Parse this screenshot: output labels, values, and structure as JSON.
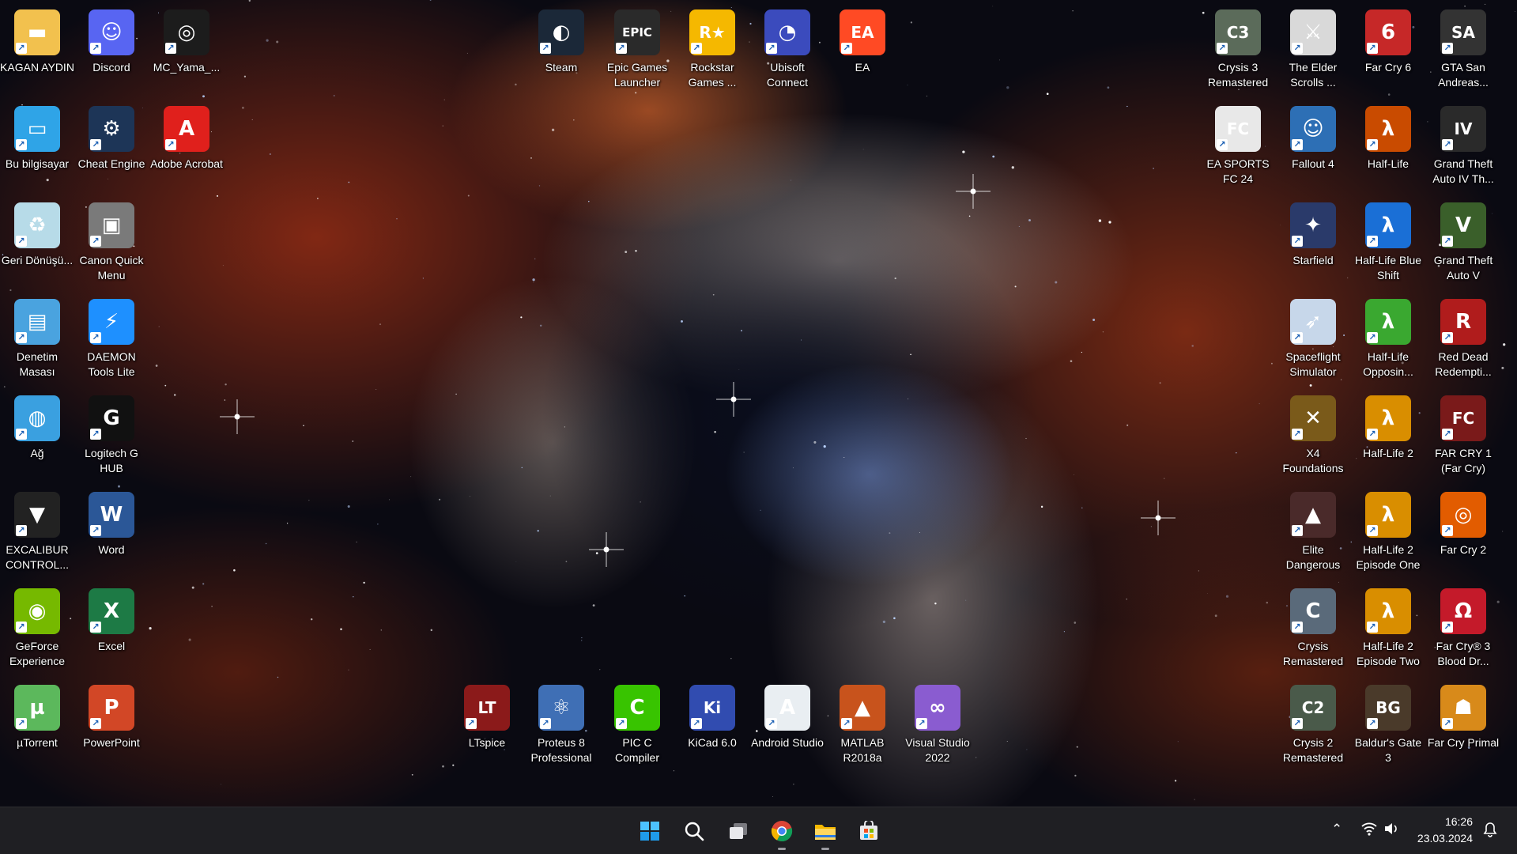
{
  "desktop": {
    "icons_left": [
      {
        "label": "KAGAN AYDIN",
        "icon": "user-folder-icon",
        "color": "#f2c14e",
        "glyph": "▬"
      },
      {
        "label": "Discord",
        "icon": "discord-icon",
        "color": "#5865f2",
        "glyph": "☺"
      },
      {
        "label": "MC_Yama_...",
        "icon": "mc-yama-icon",
        "color": "#1c1c1c",
        "glyph": "◎"
      },
      {
        "label": "Bu bilgisayar",
        "icon": "computer-icon",
        "color": "#2fa4e7",
        "glyph": "▭"
      },
      {
        "label": "Cheat Engine",
        "icon": "cheat-engine-icon",
        "color": "#1d3557",
        "glyph": "⚙"
      },
      {
        "label": "Adobe Acrobat",
        "icon": "adobe-acrobat-icon",
        "color": "#e0201c",
        "glyph": "A"
      },
      {
        "label": "Geri Dönüşü...",
        "icon": "recycle-bin-icon",
        "color": "#b7dbe8",
        "glyph": "♻"
      },
      {
        "label": "Canon Quick Menu",
        "icon": "canon-quick-menu-icon",
        "color": "#7a7a7a",
        "glyph": "▣"
      },
      {
        "label": "Denetim Masası",
        "icon": "control-panel-icon",
        "color": "#4aa3df",
        "glyph": "▤"
      },
      {
        "label": "DAEMON Tools Lite",
        "icon": "daemon-tools-icon",
        "color": "#1e90ff",
        "glyph": "⚡"
      },
      {
        "label": "Ağ",
        "icon": "network-icon",
        "color": "#3aa0e0",
        "glyph": "◍"
      },
      {
        "label": "Logitech G HUB",
        "icon": "logitech-ghub-icon",
        "color": "#111111",
        "glyph": "G"
      },
      {
        "label": "EXCALIBUR CONTROL...",
        "icon": "excalibur-icon",
        "color": "#222222",
        "glyph": "▼"
      },
      {
        "label": "Word",
        "icon": "word-icon",
        "color": "#2b5797",
        "glyph": "W"
      },
      {
        "label": "GeForce Experience",
        "icon": "geforce-icon",
        "color": "#76b900",
        "glyph": "◉"
      },
      {
        "label": "Excel",
        "icon": "excel-icon",
        "color": "#1d7a45",
        "glyph": "X"
      },
      {
        "label": "µTorrent",
        "icon": "utorrent-icon",
        "color": "#5cb85c",
        "glyph": "µ"
      },
      {
        "label": "PowerPoint",
        "icon": "powerpoint-icon",
        "color": "#d24726",
        "glyph": "P"
      }
    ],
    "icons_top": [
      {
        "label": "Steam",
        "icon": "steam-icon",
        "color": "#1b2838",
        "glyph": "◐"
      },
      {
        "label": "Epic Games Launcher",
        "icon": "epic-games-icon",
        "color": "#2a2a2a",
        "glyph": "EPIC"
      },
      {
        "label": "Rockstar Games ...",
        "icon": "rockstar-icon",
        "color": "#f5b800",
        "glyph": "R★"
      },
      {
        "label": "Ubisoft Connect",
        "icon": "ubisoft-icon",
        "color": "#3b4bbd",
        "glyph": "◔"
      },
      {
        "label": "EA",
        "icon": "ea-icon",
        "color": "#ff4a24",
        "glyph": "EA"
      }
    ],
    "icons_bottom": [
      {
        "label": "LTspice",
        "icon": "ltspice-icon",
        "color": "#8b1a1a",
        "glyph": "LT"
      },
      {
        "label": "Proteus 8 Professional",
        "icon": "proteus-icon",
        "color": "#3f6fb5",
        "glyph": "⚛"
      },
      {
        "label": "PIC C Compiler",
        "icon": "pic-c-compiler-icon",
        "color": "#38c400",
        "glyph": "C"
      },
      {
        "label": "KiCad 6.0",
        "icon": "kicad-icon",
        "color": "#314cb0",
        "glyph": "Ki"
      },
      {
        "label": "Android Studio",
        "icon": "android-studio-icon",
        "color": "#e9eef2",
        "glyph": "A"
      },
      {
        "label": "MATLAB R2018a",
        "icon": "matlab-icon",
        "color": "#c8531c",
        "glyph": "▲"
      },
      {
        "label": "Visual Studio 2022",
        "icon": "visual-studio-icon",
        "color": "#8a5cd0",
        "glyph": "∞"
      }
    ],
    "icons_right": [
      {
        "label": "Crysis 3 Remastered",
        "icon": "crysis3-icon",
        "color": "#5b6b5a",
        "glyph": "C3"
      },
      {
        "label": "The Elder Scrolls ...",
        "icon": "elder-scrolls-icon",
        "color": "#d9d9d9",
        "glyph": "⚔"
      },
      {
        "label": "Far Cry 6",
        "icon": "farcry6-icon",
        "color": "#c62828",
        "glyph": "6"
      },
      {
        "label": "GTA San Andreas...",
        "icon": "gta-sa-icon",
        "color": "#333333",
        "glyph": "SA"
      },
      {
        "label": "EA SPORTS FC 24",
        "icon": "ea-fc24-icon",
        "color": "#e8e8e8",
        "glyph": "FC"
      },
      {
        "label": "Fallout 4",
        "icon": "fallout4-icon",
        "color": "#2d6fb5",
        "glyph": "☺"
      },
      {
        "label": "Half-Life",
        "icon": "half-life-icon",
        "color": "#c94b00",
        "glyph": "λ"
      },
      {
        "label": "Grand Theft Auto IV Th...",
        "icon": "gta4-icon",
        "color": "#2a2a2a",
        "glyph": "IV"
      },
      {
        "label": "Starfield",
        "icon": "starfield-icon",
        "color": "#2a3a6a",
        "glyph": "✦"
      },
      {
        "label": "Half-Life Blue Shift",
        "icon": "half-life-blue-shift-icon",
        "color": "#1a6fd6",
        "glyph": "λ"
      },
      {
        "label": "Grand Theft Auto V",
        "icon": "gta5-icon",
        "color": "#3a5f2a",
        "glyph": "V"
      },
      {
        "label": "Spaceflight Simulator",
        "icon": "spaceflight-simulator-icon",
        "color": "#c7d7ea",
        "glyph": "➶"
      },
      {
        "label": "Half-Life Opposin...",
        "icon": "half-life-opposing-force-icon",
        "color": "#3aa830",
        "glyph": "λ"
      },
      {
        "label": "Red Dead Redempti...",
        "icon": "red-dead-icon",
        "color": "#b01c1c",
        "glyph": "R"
      },
      {
        "label": "X4 Foundations",
        "icon": "x4-foundations-icon",
        "color": "#7a5a1a",
        "glyph": "✕"
      },
      {
        "label": "Half-Life 2",
        "icon": "half-life-2-icon",
        "color": "#d98e00",
        "glyph": "λ"
      },
      {
        "label": "FAR CRY 1 (Far Cry)",
        "icon": "farcry1-icon",
        "color": "#7a1a1a",
        "glyph": "FC"
      },
      {
        "label": "Elite Dangerous",
        "icon": "elite-dangerous-icon",
        "color": "#4a2a2a",
        "glyph": "▲"
      },
      {
        "label": "Half-Life 2 Episode One",
        "icon": "half-life-2-ep1-icon",
        "color": "#d98e00",
        "glyph": "λ"
      },
      {
        "label": "Far Cry 2",
        "icon": "farcry2-icon",
        "color": "#e25c00",
        "glyph": "◎"
      },
      {
        "label": "Crysis Remastered",
        "icon": "crysis-remastered-icon",
        "color": "#5a6a7a",
        "glyph": "C"
      },
      {
        "label": "Half-Life 2 Episode Two",
        "icon": "half-life-2-ep2-icon",
        "color": "#d98e00",
        "glyph": "λ"
      },
      {
        "label": "Far Cry® 3 Blood Dr...",
        "icon": "farcry3-blood-dragon-icon",
        "color": "#c41a2a",
        "glyph": "Ω"
      },
      {
        "label": "Crysis 2 Remastered",
        "icon": "crysis2-icon",
        "color": "#4a5a4a",
        "glyph": "C2"
      },
      {
        "label": "Baldur's Gate 3",
        "icon": "baldurs-gate-3-icon",
        "color": "#4a3a2a",
        "glyph": "BG"
      },
      {
        "label": "Far Cry Primal",
        "icon": "farcry-primal-icon",
        "color": "#d88a1a",
        "glyph": "☗"
      }
    ]
  },
  "taskbar": {
    "apps": [
      {
        "name": "start",
        "icon": "windows-start-icon"
      },
      {
        "name": "search",
        "icon": "search-icon"
      },
      {
        "name": "task-view",
        "icon": "task-view-icon"
      },
      {
        "name": "chrome",
        "icon": "chrome-icon",
        "running": true
      },
      {
        "name": "file-explorer",
        "icon": "file-explorer-icon",
        "running": true
      },
      {
        "name": "microsoft-store",
        "icon": "microsoft-store-icon"
      }
    ],
    "tray": {
      "time": "16:26",
      "date": "23.03.2024"
    }
  },
  "colors": {
    "taskbar_bg": "#1f1f23",
    "label_text": "#ffffff"
  }
}
